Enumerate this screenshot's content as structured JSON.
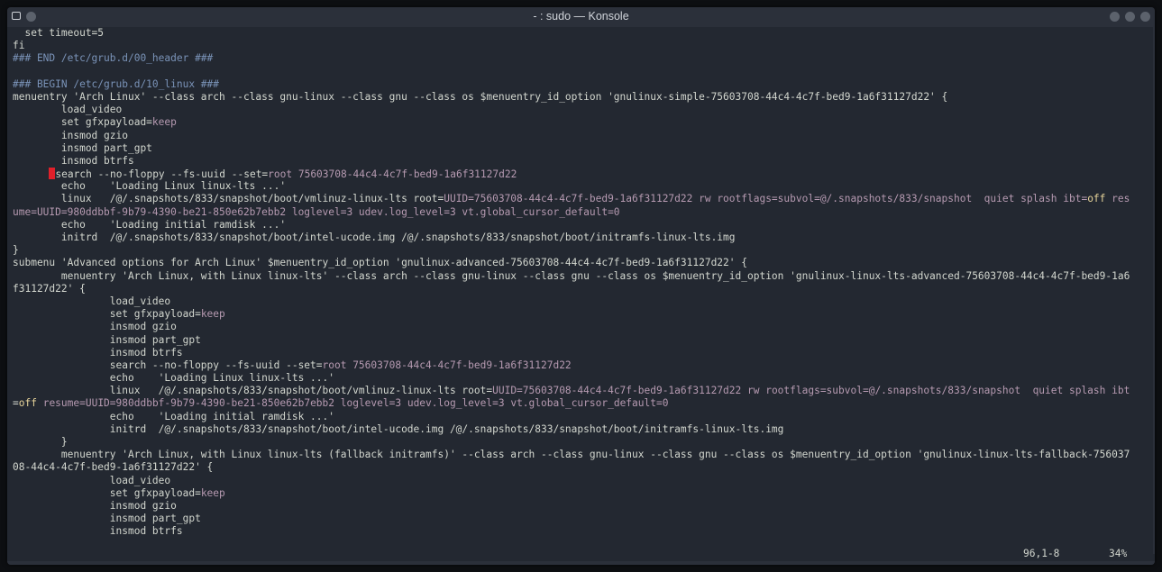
{
  "window": {
    "title": "- : sudo — Konsole"
  },
  "colors": {
    "background": "#232831",
    "text": "#d3d7cf",
    "comment": "#7a93b8",
    "value": "#b69ab1",
    "keyword": "#e7d49a",
    "cursor": "#e0202a"
  },
  "icons": {
    "menu": "window-menu-icon",
    "pin": "pin-icon",
    "minimize": "minimize-icon",
    "maximize": "maximize-icon",
    "close": "close-icon"
  },
  "terminal": {
    "lines": [
      {
        "t": "  set timeout=5"
      },
      {
        "t": "fi"
      },
      {
        "t": "### END /etc/grub.d/00_header ###",
        "c": "cm"
      },
      {
        "t": ""
      },
      {
        "t": "### BEGIN /etc/grub.d/10_linux ###",
        "c": "cm"
      },
      {
        "t": "menuentry 'Arch Linux' --class arch --class gnu-linux --class gnu --class os $menuentry_id_option 'gnulinux-simple-75603708-44c4-4c7f-bed9-1a6f31127d22' {"
      },
      {
        "t": "        load_video"
      },
      {
        "segs": [
          {
            "t": "        set gfxpayload="
          },
          {
            "t": "keep",
            "c": "vl"
          }
        ]
      },
      {
        "t": "        insmod gzio"
      },
      {
        "t": "        insmod part_gpt"
      },
      {
        "t": "        insmod btrfs"
      },
      {
        "cursor": true,
        "segs": [
          {
            "t": "search --no-floppy --fs-uuid --set="
          },
          {
            "t": "root 75603708-44c4-4c7f-bed9-1a6f31127d22",
            "c": "vl"
          }
        ]
      },
      {
        "t": "        echo    'Loading Linux linux-lts ...'"
      },
      {
        "segs": [
          {
            "t": "        linux   /@/.snapshots/833/snapshot/boot/vmlinuz-linux-lts root="
          },
          {
            "t": "UUID=75603708-44c4-4c7f-bed9-1a6f31127d22 rw rootflags=subvol=@/.snapshots/833/snapshot  quiet splash ibt=",
            "c": "vl"
          },
          {
            "t": "off",
            "c": "kw"
          },
          {
            "t": " res",
            "c": "vl"
          }
        ]
      },
      {
        "segs": [
          {
            "t": "ume=UUID=980ddbbf-9b79-4390-be21-850e62b7ebb2 loglevel=3 udev.log_level=3 vt.global_cursor_default=0",
            "c": "vl"
          }
        ]
      },
      {
        "t": "        echo    'Loading initial ramdisk ...'"
      },
      {
        "t": "        initrd  /@/.snapshots/833/snapshot/boot/intel-ucode.img /@/.snapshots/833/snapshot/boot/initramfs-linux-lts.img"
      },
      {
        "t": "}"
      },
      {
        "t": "submenu 'Advanced options for Arch Linux' $menuentry_id_option 'gnulinux-advanced-75603708-44c4-4c7f-bed9-1a6f31127d22' {"
      },
      {
        "t": "        menuentry 'Arch Linux, with Linux linux-lts' --class arch --class gnu-linux --class gnu --class os $menuentry_id_option 'gnulinux-linux-lts-advanced-75603708-44c4-4c7f-bed9-1a6"
      },
      {
        "t": "f31127d22' {"
      },
      {
        "t": "                load_video"
      },
      {
        "segs": [
          {
            "t": "                set gfxpayload="
          },
          {
            "t": "keep",
            "c": "vl"
          }
        ]
      },
      {
        "t": "                insmod gzio"
      },
      {
        "t": "                insmod part_gpt"
      },
      {
        "t": "                insmod btrfs"
      },
      {
        "segs": [
          {
            "t": "                search --no-floppy --fs-uuid --set="
          },
          {
            "t": "root 75603708-44c4-4c7f-bed9-1a6f31127d22",
            "c": "vl"
          }
        ]
      },
      {
        "t": "                echo    'Loading Linux linux-lts ...'"
      },
      {
        "segs": [
          {
            "t": "                linux   /@/.snapshots/833/snapshot/boot/vmlinuz-linux-lts root="
          },
          {
            "t": "UUID=75603708-44c4-4c7f-bed9-1a6f31127d22 rw rootflags=subvol=@/.snapshots/833/snapshot  quiet splash ibt",
            "c": "vl"
          }
        ]
      },
      {
        "segs": [
          {
            "t": "="
          },
          {
            "t": "off",
            "c": "kw"
          },
          {
            "t": " resume=UUID=980ddbbf-9b79-4390-be21-850e62b7ebb2 loglevel=3 udev.log_level=3 vt.global_cursor_default=0",
            "c": "vl"
          }
        ]
      },
      {
        "t": "                echo    'Loading initial ramdisk ...'"
      },
      {
        "t": "                initrd  /@/.snapshots/833/snapshot/boot/intel-ucode.img /@/.snapshots/833/snapshot/boot/initramfs-linux-lts.img"
      },
      {
        "t": "        }"
      },
      {
        "t": "        menuentry 'Arch Linux, with Linux linux-lts (fallback initramfs)' --class arch --class gnu-linux --class gnu --class os $menuentry_id_option 'gnulinux-linux-lts-fallback-756037"
      },
      {
        "t": "08-44c4-4c7f-bed9-1a6f31127d22' {"
      },
      {
        "t": "                load_video"
      },
      {
        "segs": [
          {
            "t": "                set gfxpayload="
          },
          {
            "t": "keep",
            "c": "vl"
          }
        ]
      },
      {
        "t": "                insmod gzio"
      },
      {
        "t": "                insmod part_gpt"
      },
      {
        "t": "                insmod btrfs"
      }
    ]
  },
  "statusline": {
    "position": "96,1-8",
    "percent": "34%"
  }
}
